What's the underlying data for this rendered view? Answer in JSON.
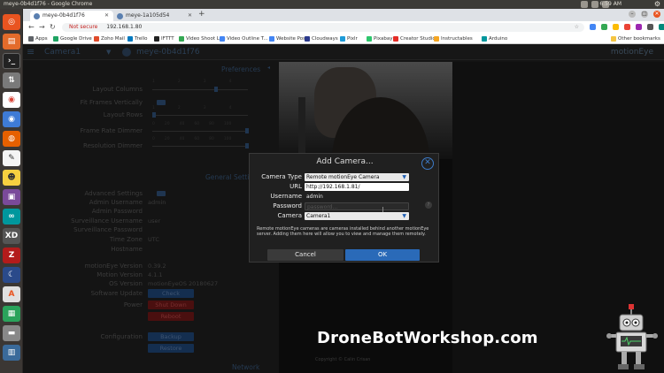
{
  "os": {
    "window_title": "meye-0b4d1f76 - Google Chrome",
    "clock": "6:59 AM"
  },
  "browser": {
    "tabs": [
      {
        "label": "meye-0b4d1f76",
        "active": true
      },
      {
        "label": "meye-1a105d54",
        "active": false
      }
    ],
    "new_tab": "+",
    "address": {
      "security": "Not secure",
      "url": "192.168.1.80"
    },
    "bookmarks": [
      {
        "label": "Apps",
        "color": "#5f6368"
      },
      {
        "label": "Google Drive",
        "color": "#1fa463"
      },
      {
        "label": "Zoho Mail",
        "color": "#e04b2b"
      },
      {
        "label": "Trello",
        "color": "#0079bf"
      },
      {
        "label": "IFTTT",
        "color": "#222222"
      },
      {
        "label": "Video Shoot Log",
        "color": "#34a853"
      },
      {
        "label": "Video Outline T...",
        "color": "#4285f4"
      },
      {
        "label": "Website Posts",
        "color": "#4285f4"
      },
      {
        "label": "Cloudways",
        "color": "#2c3a8c"
      },
      {
        "label": "Pixlr",
        "color": "#1d9bd8"
      },
      {
        "label": "Pixabay",
        "color": "#2ec66d"
      },
      {
        "label": "Creator Studio",
        "color": "#e52d27"
      },
      {
        "label": "Instructables",
        "color": "#f5a623"
      },
      {
        "label": "Arduino",
        "color": "#00979d"
      }
    ],
    "other_bookmarks": "Other bookmarks"
  },
  "motioneye": {
    "header": {
      "camera_select": "Camera1",
      "camera_name": "meye-0b4d1f76",
      "brand": "motionEye"
    },
    "sections": {
      "preferences": "Preferences",
      "general": "General Settings",
      "network": "Network"
    },
    "preferences": {
      "layout_columns": "Layout Columns",
      "fit_frames": "Fit Frames Vertically",
      "layout_rows": "Layout Rows",
      "frame_rate_dimmer": "Frame Rate Dimmer",
      "resolution_dimmer": "Resolution Dimmer",
      "columns_ticks": [
        "1",
        "2",
        "3",
        "4"
      ],
      "rows_ticks": [
        "1",
        "2",
        "3",
        "4"
      ],
      "dimmer_ticks": [
        "0",
        "10",
        "20",
        "30",
        "40",
        "50",
        "60",
        "70",
        "80",
        "90",
        "100"
      ]
    },
    "general": {
      "advanced_settings": "Advanced Settings",
      "admin_username": "Admin Username",
      "admin_username_value": "admin",
      "admin_password": "Admin Password",
      "surveillance_username": "Surveillance Username",
      "surveillance_username_value": "user",
      "surveillance_password": "Surveillance Password",
      "time_zone": "Time Zone",
      "time_zone_value": "UTC",
      "hostname": "Hostname",
      "motioneye_version": "motionEye Version",
      "motioneye_version_value": "0.39.2",
      "motion_version": "Motion Version",
      "motion_version_value": "4.1.1",
      "os_version": "OS Version",
      "os_version_value": "motionEyeOS 20180627",
      "software_update": "Software Update",
      "check": "Check",
      "power": "Power",
      "shut_down": "Shut Down",
      "reboot": "Reboot",
      "configuration": "Configuration",
      "backup": "Backup",
      "restore": "Restore"
    },
    "copyright": "Copyright © Calin Crisan"
  },
  "dialog": {
    "title": "Add Camera...",
    "camera_type_label": "Camera Type",
    "camera_type_value": "Remote motionEye Camera",
    "url_label": "URL",
    "url_value": "http://192.168.1.81/",
    "username_label": "Username",
    "username_value": "admin",
    "password_label": "Password",
    "password_placeholder": "password...",
    "camera_label": "Camera",
    "camera_value": "Camera1",
    "help": "?",
    "description": "Remote motionEye cameras are cameras installed behind another motionEye server. Adding them here will allow you to view and manage them remotely.",
    "cancel": "Cancel",
    "ok": "OK"
  },
  "watermark": "DroneBotWorkshop.com"
}
